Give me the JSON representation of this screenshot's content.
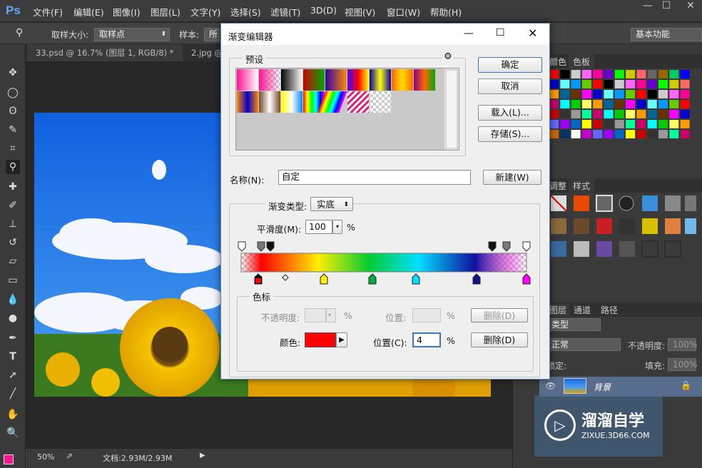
{
  "app": {
    "logo": "Ps"
  },
  "menu": [
    "文件(F)",
    "编辑(E)",
    "图像(I)",
    "图层(L)",
    "文字(Y)",
    "选择(S)",
    "滤镜(T)",
    "3D(D)",
    "视图(V)",
    "窗口(W)",
    "帮助(H)"
  ],
  "options": {
    "sample_size_label": "取样大小:",
    "sample_size_value": "取样点",
    "sample_label": "样本:",
    "sample_value": "所",
    "workspace": "基本功能"
  },
  "tabs": [
    "33.psd @ 16.7% (图层 1, RGB/8) *",
    "2.jpg @"
  ],
  "status": {
    "zoom": "50%",
    "doc": "文档:2.93M/2.93M"
  },
  "right_panel": {
    "swatch_tabs": [
      "颜色",
      "色板"
    ],
    "style_tabs": [
      "调整",
      "样式"
    ],
    "layer_tabs": [
      "图层",
      "通道",
      "路径"
    ],
    "kind_filter": "类型",
    "blend_mode": "正常",
    "opacity_label": "不透明度:",
    "opacity_value": "100%",
    "lock_label": "锁定:",
    "fill_label": "填充:",
    "fill_value": "100%",
    "layer_name": "背景"
  },
  "watermark": {
    "title": "溜溜自学",
    "url": "ZIXUE.3D66.COM"
  },
  "dialog": {
    "title": "渐变编辑器",
    "presets_label": "预设",
    "ok": "确定",
    "cancel": "取消",
    "load": "载入(L)...",
    "save": "存储(S)...",
    "name_label": "名称(N):",
    "name_value": "自定",
    "new_button": "新建(W)",
    "gradient_type_label": "渐变类型:",
    "gradient_type_value": "实底",
    "smoothness_label": "平滑度(M):",
    "smoothness_value": "100",
    "percent": "%",
    "stops_group": "色标",
    "opacity_label": "不透明度:",
    "location_label": "位置:",
    "delete_label": "删除(D)",
    "color_label": "颜色:",
    "location_c_label": "位置(C):",
    "location_value": "4",
    "stop_color": "#ff0000"
  }
}
